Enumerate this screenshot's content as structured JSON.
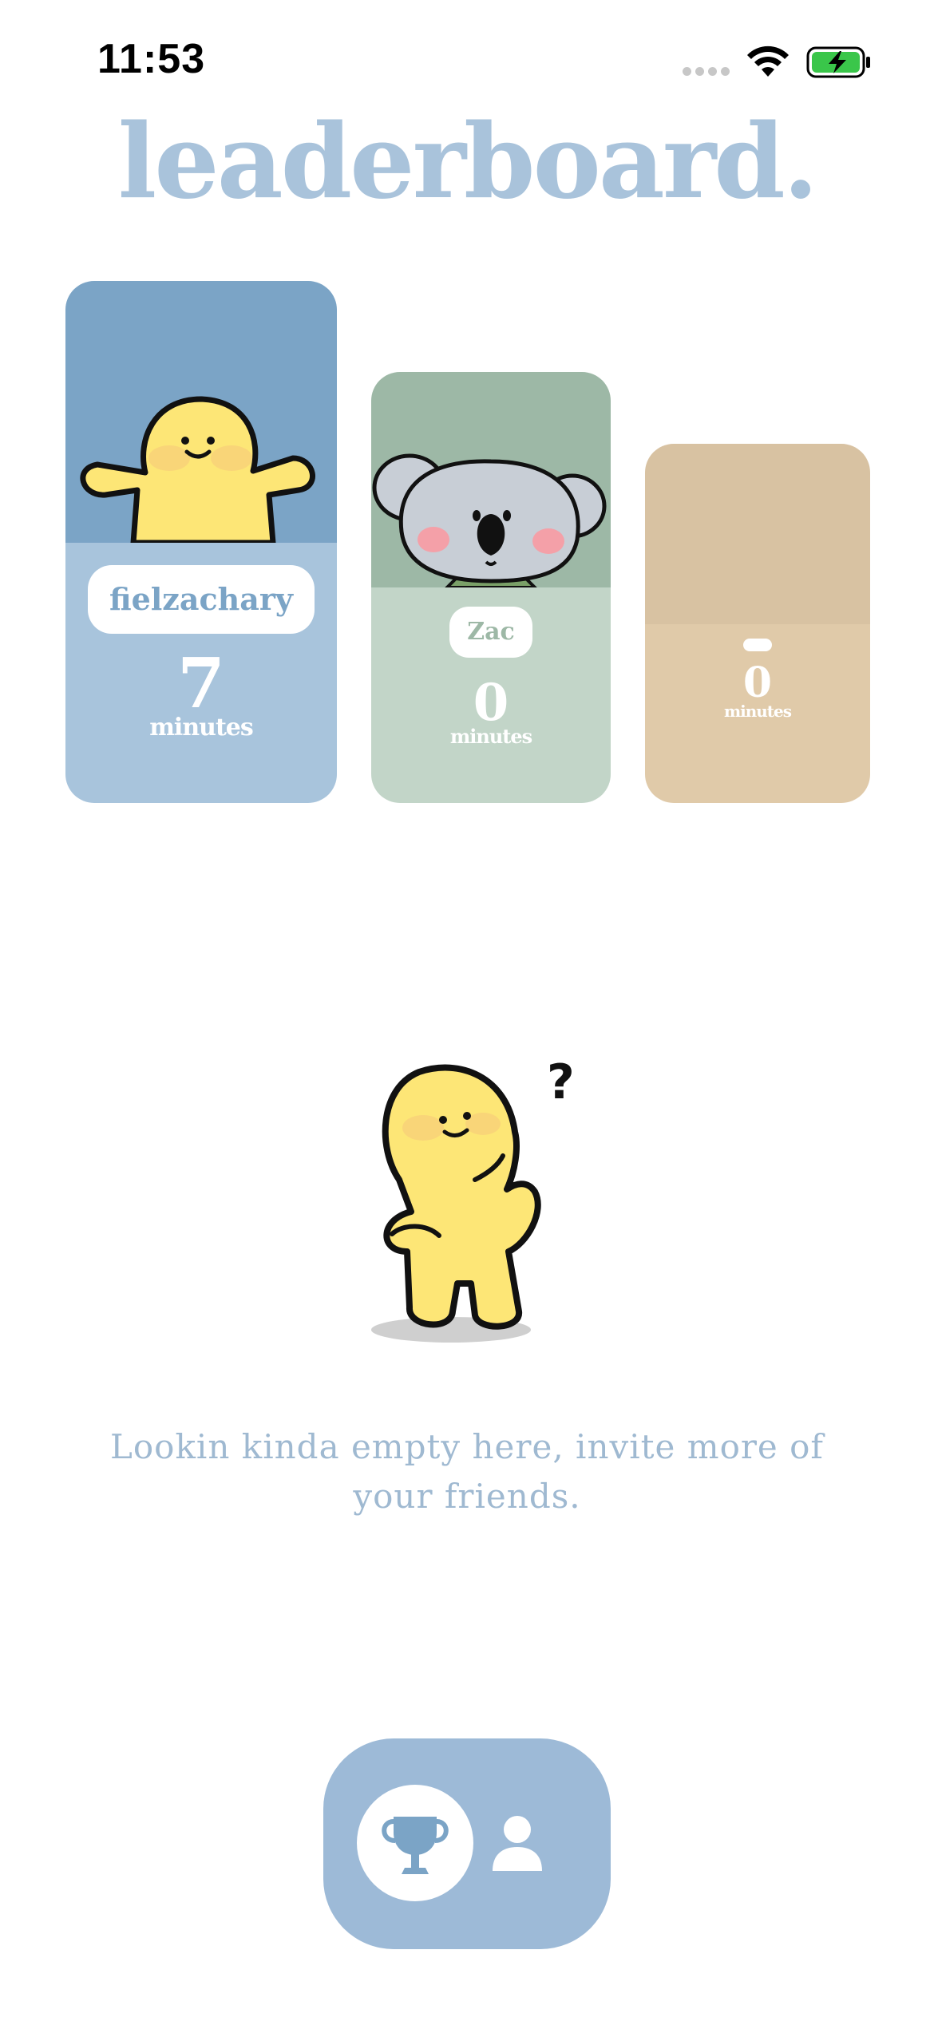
{
  "status_bar": {
    "time": "11:53"
  },
  "header": {
    "title": "leaderboard."
  },
  "leaderboard": [
    {
      "rank": 1,
      "name": "fielzachary",
      "minutes": "7",
      "minutes_label": "minutes",
      "avatar": "yellow-character-avatar",
      "color": "#7ba4c6"
    },
    {
      "rank": 2,
      "name": "Zac",
      "minutes": "0",
      "minutes_label": "minutes",
      "avatar": "koala-avatar",
      "color": "#9db8a6"
    },
    {
      "rank": 3,
      "name": "",
      "minutes": "0",
      "minutes_label": "minutes",
      "avatar": "",
      "color": "#d8c2a2"
    }
  ],
  "empty_state": {
    "message": "Lookin kinda empty here, invite more of your friends.",
    "illustration": "thinking-yellow-character"
  },
  "tab_bar": {
    "items": [
      {
        "icon": "trophy-icon",
        "active": true
      },
      {
        "icon": "person-icon",
        "active": false
      }
    ],
    "color": "#9dbad7"
  }
}
